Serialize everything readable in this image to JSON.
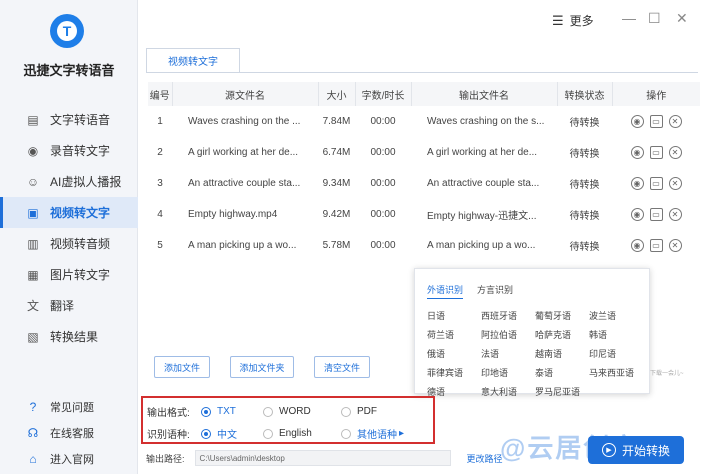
{
  "app": {
    "title": "迅捷文字转语音",
    "logo_glyph": "T"
  },
  "sidebar": {
    "items": [
      {
        "label": "文字转语音",
        "icon": "document-icon",
        "glyph": "▤"
      },
      {
        "label": "录音转文字",
        "icon": "record-icon",
        "glyph": "◉"
      },
      {
        "label": "AI虚拟人播报",
        "icon": "avatar-icon",
        "glyph": "☺"
      },
      {
        "label": "视频转文字",
        "icon": "video-icon",
        "glyph": "▣"
      },
      {
        "label": "视频转音频",
        "icon": "video-audio-icon",
        "glyph": "▥"
      },
      {
        "label": "图片转文字",
        "icon": "image-icon",
        "glyph": "▦"
      },
      {
        "label": "翻译",
        "icon": "translate-icon",
        "glyph": "文"
      },
      {
        "label": "转换结果",
        "icon": "result-icon",
        "glyph": "▧"
      }
    ],
    "footer": [
      {
        "label": "常见问题",
        "icon": "question-icon",
        "glyph": "?"
      },
      {
        "label": "在线客服",
        "icon": "headset-icon",
        "glyph": "☊"
      },
      {
        "label": "进入官网",
        "icon": "website-icon",
        "glyph": "⌂"
      }
    ]
  },
  "topbar": {
    "more_label": "更多",
    "more_glyph": "☰",
    "min_glyph": "—",
    "max_glyph": "☐",
    "close_glyph": "✕"
  },
  "tab": {
    "label": "视频转文字"
  },
  "table": {
    "headers": [
      "编号",
      "源文件名",
      "大小",
      "字数/时长",
      "输出文件名",
      "转换状态",
      "操作"
    ],
    "rows": [
      {
        "num": "1",
        "src": "Waves crashing on the ...",
        "size": "7.84M",
        "dur": "00:00",
        "out": "Waves crashing on the s...",
        "status": "待转换"
      },
      {
        "num": "2",
        "src": "A girl working at her de...",
        "size": "6.74M",
        "dur": "00:00",
        "out": "A girl working at her de...",
        "status": "待转换"
      },
      {
        "num": "3",
        "src": "An attractive couple sta...",
        "size": "9.34M",
        "dur": "00:00",
        "out": "An attractive couple sta...",
        "status": "待转换"
      },
      {
        "num": "4",
        "src": "Empty highway.mp4",
        "size": "9.42M",
        "dur": "00:00",
        "out": "Empty highway-迅捷文...",
        "status": "待转换"
      },
      {
        "num": "5",
        "src": "A man picking up a wo...",
        "size": "5.78M",
        "dur": "00:00",
        "out": "A man picking up a wo...",
        "status": "待转换"
      }
    ],
    "op_glyphs": {
      "view": "◉",
      "folder": "▭",
      "delete": "✕"
    }
  },
  "buttons": {
    "add_file": "添加文件",
    "add_folder": "添加文件夹",
    "clear_files": "清空文件"
  },
  "language_popup": {
    "tabs": [
      "外语识别",
      "方言识别"
    ],
    "languages": [
      "日语",
      "西班牙语",
      "葡萄牙语",
      "波兰语",
      "荷兰语",
      "阿拉伯语",
      "哈萨克语",
      "韩语",
      "俄语",
      "法语",
      "越南语",
      "印尼语",
      "菲律宾语",
      "印地语",
      "泰语",
      "马来西亚语",
      "德语",
      "意大利语",
      "罗马尼亚语"
    ],
    "hint": "下载一会儿~"
  },
  "options": {
    "format_label": "输出格式:",
    "formats": [
      "TXT",
      "WORD",
      "PDF"
    ],
    "selected_format": "TXT",
    "lang_label": "识别语种:",
    "langs": [
      "中文",
      "English"
    ],
    "selected_lang": "中文",
    "other_lang": "其他语种",
    "other_glyph": "▸"
  },
  "output": {
    "label": "输出路径:",
    "path": "C:\\Users\\admin\\desktop",
    "change_label": "更改路径"
  },
  "start": {
    "label": "开始转换",
    "glyph": "▶"
  },
  "watermark": "@云居创客"
}
